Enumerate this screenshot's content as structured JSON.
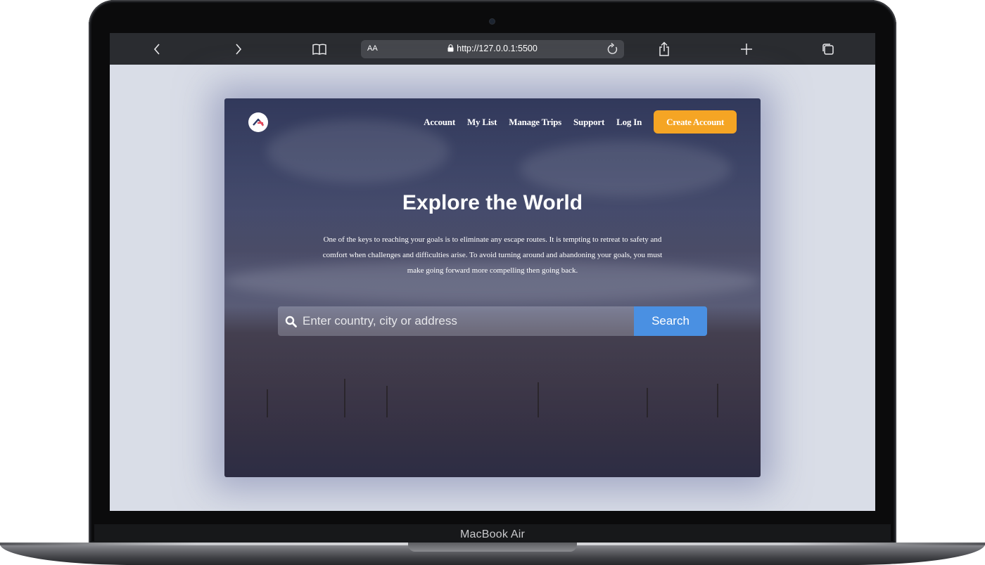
{
  "device": {
    "label": "MacBook Air"
  },
  "browser": {
    "back_icon": "chevron-left-icon",
    "forward_icon": "chevron-right-icon",
    "bookmarks_icon": "book-icon",
    "text_size_label": "AA",
    "url": "http://127.0.0.1:5500",
    "lock_icon": "lock-icon",
    "reload_icon": "reload-icon",
    "share_icon": "share-icon",
    "new_tab_icon": "plus-icon",
    "tabs_icon": "tabs-icon"
  },
  "site": {
    "logo_icon": "compass-logo-icon",
    "nav": {
      "links": [
        "Account",
        "My List",
        "Manage Trips",
        "Support",
        "Log In"
      ],
      "cta_label": "Create Account"
    },
    "hero": {
      "title": "Explore the World",
      "text": "One of the keys to reaching your goals is to eliminate any escape routes. It is tempting to retreat to safety and comfort when challenges and difficulties arise. To avoid turning around and abandoning your goals, you must make going forward more compelling then going back."
    },
    "search": {
      "icon": "search-icon",
      "placeholder": "Enter country, city or address",
      "button_label": "Search"
    }
  },
  "colors": {
    "cta": "#f5a524",
    "search_button": "#4a90e2",
    "screen_background": "#d9dde7",
    "toolbar": "#2a2c30"
  }
}
